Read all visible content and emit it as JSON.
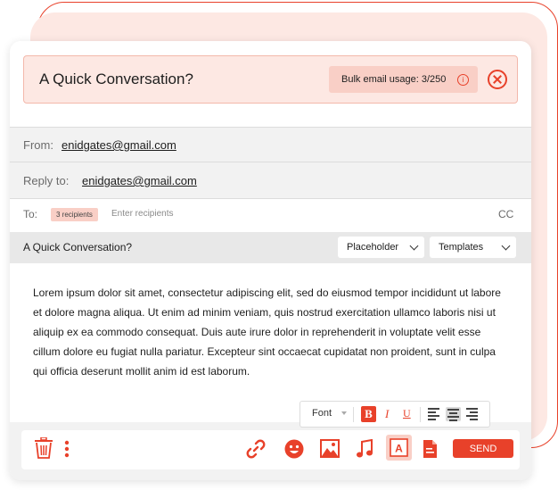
{
  "header": {
    "title": "A Quick Conversation?",
    "usage_label": "Bulk email usage: 3/250"
  },
  "from": {
    "label": "From:",
    "email": "enidgates@gmail.com"
  },
  "reply_to": {
    "label": "Reply to:",
    "email": "enidgates@gmail.com"
  },
  "to": {
    "label": "To:",
    "recipients_badge": "3 recipients",
    "placeholder": "Enter recipients",
    "cc_label": "CC"
  },
  "subject": {
    "text": "A Quick Conversation?",
    "placeholder_dropdown": "Placeholder",
    "templates_dropdown": "Templates"
  },
  "body": {
    "text": "Lorem ipsum dolor sit amet, consectetur adipiscing elit, sed do eiusmod tempor incididunt ut labore et dolore magna aliqua. Ut enim ad minim veniam, quis nostrud exercitation ullamco laboris nisi ut aliquip ex ea commodo consequat. Duis aute irure dolor in reprehenderit in voluptate velit esse cillum dolore eu fugiat nulla pariatur. Excepteur sint occaecat cupidatat non proident, sunt in culpa qui officia deserunt mollit anim id est laborum."
  },
  "format_bar": {
    "font_label": "Font",
    "bold": "B",
    "italic": "I",
    "underline": "U",
    "active_alignment": "center"
  },
  "toolbar": {
    "icons": [
      "trash-icon",
      "more-vertical-icon",
      "link-icon",
      "emoji-icon",
      "image-icon",
      "music-icon",
      "text-format-icon",
      "document-icon"
    ],
    "text_format_letter": "A",
    "send_label": "SEND"
  },
  "colors": {
    "accent": "#e8412a",
    "accent_light": "#fde8e3",
    "badge": "#f9cfc6"
  }
}
